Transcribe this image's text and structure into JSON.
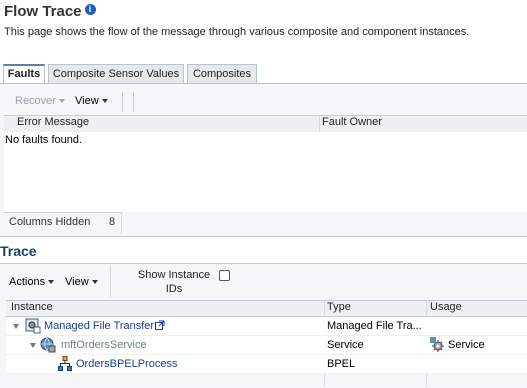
{
  "header": {
    "title": "Flow Trace",
    "info_icon": "i",
    "description": "This page shows the flow of the message through various composite and component instances."
  },
  "tabs": [
    {
      "label": "Faults",
      "active": true
    },
    {
      "label": "Composite Sensor Values",
      "active": false
    },
    {
      "label": "Composites",
      "active": false
    }
  ],
  "faults": {
    "toolbar": {
      "recover_label": "Recover",
      "view_label": "View"
    },
    "columns": [
      "Error Message",
      "Fault Owner"
    ],
    "empty_message": "No faults found.",
    "columns_hidden_label": "Columns Hidden",
    "columns_hidden_count": "8"
  },
  "trace": {
    "title": "Trace",
    "toolbar": {
      "actions_label": "Actions",
      "view_label": "View",
      "show_ids_line1": "Show Instance",
      "show_ids_line2": "IDs",
      "show_ids_checked": false
    },
    "columns": [
      "Instance",
      "Type",
      "Usage"
    ],
    "rows": [
      {
        "instance": "Managed File Transfer",
        "type": "Managed File Tra...",
        "usage": "",
        "level": 0,
        "icon": "composite-icon"
      },
      {
        "instance": "mftOrdersService",
        "type": "Service",
        "usage": "Service",
        "level": 1,
        "icon": "service-icon"
      },
      {
        "instance": "OrdersBPELProcess",
        "type": "BPEL",
        "usage": "",
        "level": 2,
        "icon": "bpel-process-icon"
      }
    ]
  },
  "colors": {
    "link": "#1a3d8f",
    "trace_title": "#1c3f66",
    "panel_bg": "#f4f6f8",
    "border": "#c5ced6"
  }
}
